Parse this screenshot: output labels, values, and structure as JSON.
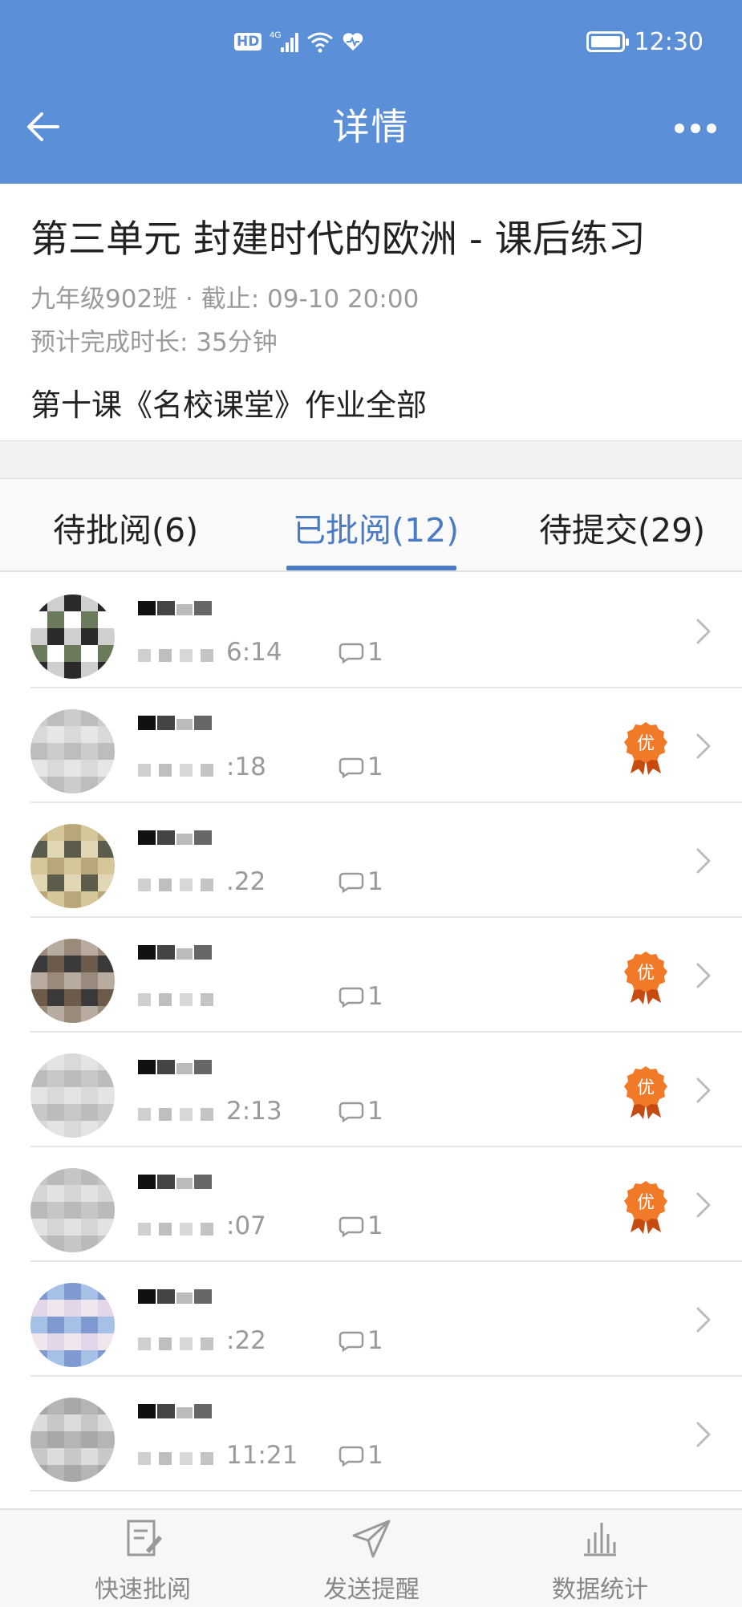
{
  "status_bar": {
    "hd_label": "HD",
    "network_label": "4G",
    "time": "12:30"
  },
  "nav": {
    "title": "详情",
    "back_icon": "arrow-left-icon",
    "more_icon": "more-dots-icon"
  },
  "homework": {
    "title": "第三单元 封建时代的欧洲 - 课后练习",
    "meta": "九年级902班 · 截止: 09-10 20:00",
    "duration": "预计完成时长: 35分钟",
    "content": "第十课《名校课堂》作业全部"
  },
  "tabs": [
    {
      "label": "待批阅(6)",
      "active": false
    },
    {
      "label": "已批阅(12)",
      "active": true
    },
    {
      "label": "待提交(29)",
      "active": false
    }
  ],
  "list": [
    {
      "time": "6:14",
      "comments": "1",
      "excellent": false
    },
    {
      "time": ":18",
      "comments": "1",
      "excellent": true
    },
    {
      "time": ".22",
      "comments": "1",
      "excellent": false
    },
    {
      "time": "",
      "comments": "1",
      "excellent": true
    },
    {
      "time": "2:13",
      "comments": "1",
      "excellent": true
    },
    {
      "time": ":07",
      "comments": "1",
      "excellent": true
    },
    {
      "time": ":22",
      "comments": "1",
      "excellent": false
    },
    {
      "time": "11:21",
      "comments": "1",
      "excellent": false
    }
  ],
  "badge_label": "优",
  "bottom_bar": [
    {
      "label": "快速批阅",
      "icon": "quick-review-icon"
    },
    {
      "label": "发送提醒",
      "icon": "send-reminder-icon"
    },
    {
      "label": "数据统计",
      "icon": "stats-chart-icon"
    }
  ],
  "colors": {
    "primary": "#5b8fd8",
    "tab_active": "#4a7cc4",
    "badge": "#f07a28"
  }
}
